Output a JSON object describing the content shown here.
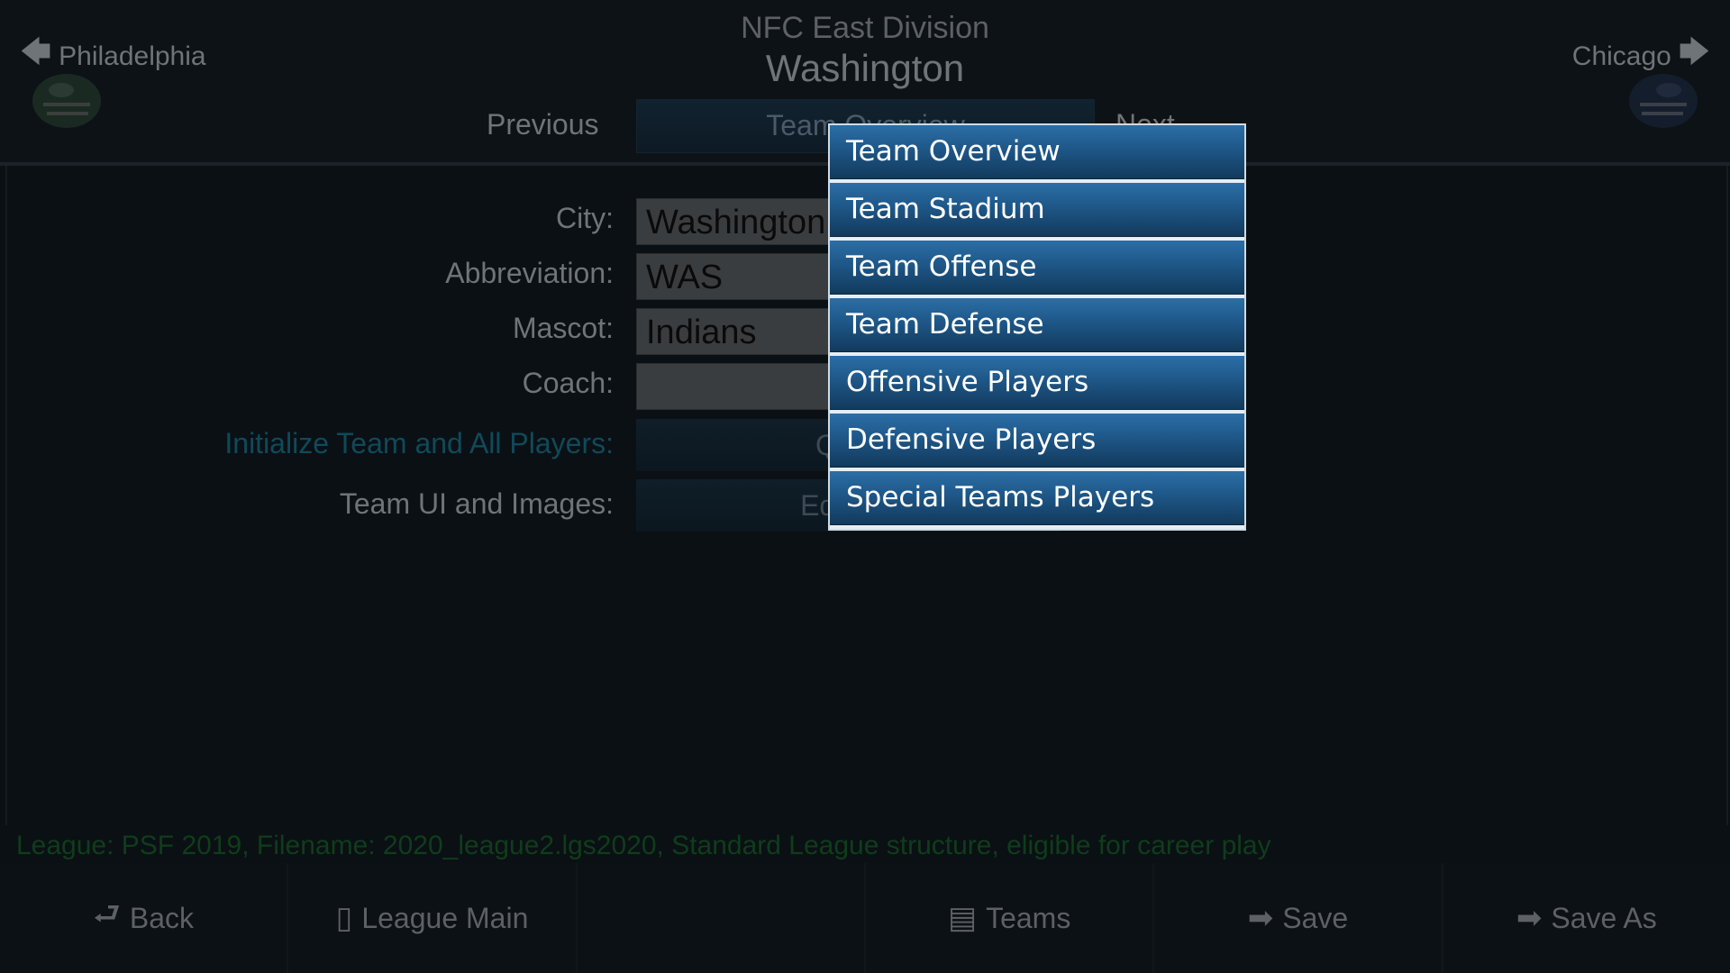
{
  "header": {
    "division": "NFC East Division",
    "team_name": "Washington",
    "prev_team": "Philadelphia",
    "next_team": "Chicago",
    "prev_label": "Previous",
    "next_label": "Next",
    "view_selected": "Team Overview"
  },
  "form": {
    "city_label": "City:",
    "city_value": "Washington",
    "abbr_label": "Abbreviation:",
    "abbr_value": "WAS",
    "mascot_label": "Mascot:",
    "mascot_value": "Indians",
    "coach_label": "Coach:",
    "coach_value": "",
    "init_label": "Initialize Team and All Players:",
    "init_button": "Quick S",
    "ui_label": "Team UI and Images:",
    "ui_button": "Edit UI Co"
  },
  "menu": {
    "items": [
      "Team Overview",
      "Team Stadium",
      "Team Offense",
      "Team Defense",
      "Offensive Players",
      "Defensive Players",
      "Special Teams Players"
    ]
  },
  "status": "League: PSF 2019,  Filename: 2020_league2.lgs2020,  Standard League structure, eligible for career play",
  "footer": {
    "back": "Back",
    "league_main": "League Main",
    "teams": "Teams",
    "save": "Save",
    "save_as": "Save As"
  },
  "colors": {
    "menu_item": "#1e5788",
    "status_text": "#0f3d1b",
    "link_label": "#0f4a5a"
  },
  "icons": {
    "prev": "arrow-left-icon",
    "next": "arrow-right-icon",
    "back": "return-arrow-icon",
    "league_main": "clipboard-icon",
    "teams": "roster-icon",
    "save": "arrow-right-icon",
    "save_as": "arrow-right-icon"
  }
}
